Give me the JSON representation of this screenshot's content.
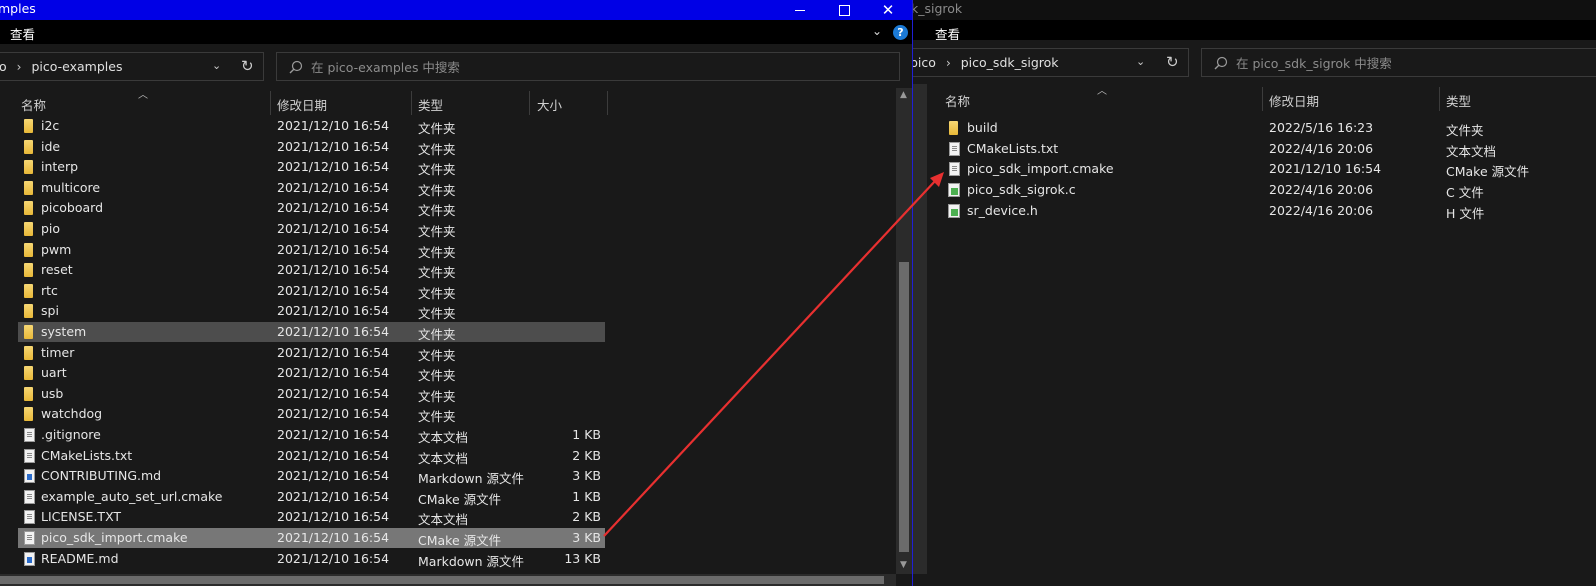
{
  "left": {
    "title": "mples",
    "ribbon": {
      "view_tab": "查看",
      "help": "?"
    },
    "address": {
      "prefix": "o",
      "folder": "pico-examples"
    },
    "search": {
      "placeholder": "在 pico-examples 中搜索"
    },
    "columns": {
      "name": "名称",
      "modified": "修改日期",
      "type": "类型",
      "size": "大小"
    },
    "rows": [
      {
        "name": "i2c",
        "modified": "2021/12/10 16:54",
        "type": "文件夹",
        "size": "",
        "icon": "folder-icon"
      },
      {
        "name": "ide",
        "modified": "2021/12/10 16:54",
        "type": "文件夹",
        "size": "",
        "icon": "folder-icon"
      },
      {
        "name": "interp",
        "modified": "2021/12/10 16:54",
        "type": "文件夹",
        "size": "",
        "icon": "folder-icon"
      },
      {
        "name": "multicore",
        "modified": "2021/12/10 16:54",
        "type": "文件夹",
        "size": "",
        "icon": "folder-icon"
      },
      {
        "name": "picoboard",
        "modified": "2021/12/10 16:54",
        "type": "文件夹",
        "size": "",
        "icon": "folder-icon"
      },
      {
        "name": "pio",
        "modified": "2021/12/10 16:54",
        "type": "文件夹",
        "size": "",
        "icon": "folder-icon"
      },
      {
        "name": "pwm",
        "modified": "2021/12/10 16:54",
        "type": "文件夹",
        "size": "",
        "icon": "folder-icon"
      },
      {
        "name": "reset",
        "modified": "2021/12/10 16:54",
        "type": "文件夹",
        "size": "",
        "icon": "folder-icon"
      },
      {
        "name": "rtc",
        "modified": "2021/12/10 16:54",
        "type": "文件夹",
        "size": "",
        "icon": "folder-icon"
      },
      {
        "name": "spi",
        "modified": "2021/12/10 16:54",
        "type": "文件夹",
        "size": "",
        "icon": "folder-icon"
      },
      {
        "name": "system",
        "modified": "2021/12/10 16:54",
        "type": "文件夹",
        "size": "",
        "icon": "folder-icon",
        "highlight": "hover"
      },
      {
        "name": "timer",
        "modified": "2021/12/10 16:54",
        "type": "文件夹",
        "size": "",
        "icon": "folder-icon"
      },
      {
        "name": "uart",
        "modified": "2021/12/10 16:54",
        "type": "文件夹",
        "size": "",
        "icon": "folder-icon"
      },
      {
        "name": "usb",
        "modified": "2021/12/10 16:54",
        "type": "文件夹",
        "size": "",
        "icon": "folder-icon"
      },
      {
        "name": "watchdog",
        "modified": "2021/12/10 16:54",
        "type": "文件夹",
        "size": "",
        "icon": "folder-icon"
      },
      {
        "name": ".gitignore",
        "modified": "2021/12/10 16:54",
        "type": "文本文档",
        "size": "1 KB",
        "icon": "text-file-icon"
      },
      {
        "name": "CMakeLists.txt",
        "modified": "2021/12/10 16:54",
        "type": "文本文档",
        "size": "2 KB",
        "icon": "text-file-icon"
      },
      {
        "name": "CONTRIBUTING.md",
        "modified": "2021/12/10 16:54",
        "type": "Markdown 源文件",
        "size": "3 KB",
        "icon": "markdown-file-icon"
      },
      {
        "name": "example_auto_set_url.cmake",
        "modified": "2021/12/10 16:54",
        "type": "CMake 源文件",
        "size": "1 KB",
        "icon": "text-file-icon"
      },
      {
        "name": "LICENSE.TXT",
        "modified": "2021/12/10 16:54",
        "type": "文本文档",
        "size": "2 KB",
        "icon": "text-file-icon"
      },
      {
        "name": "pico_sdk_import.cmake",
        "modified": "2021/12/10 16:54",
        "type": "CMake 源文件",
        "size": "3 KB",
        "icon": "text-file-icon",
        "highlight": "selected"
      },
      {
        "name": "README.md",
        "modified": "2021/12/10 16:54",
        "type": "Markdown 源文件",
        "size": "13 KB",
        "icon": "markdown-file-icon"
      }
    ]
  },
  "right": {
    "title": "k_sigrok",
    "ribbon": {
      "view_tab": "查看"
    },
    "address": {
      "prefix": "pico",
      "folder": "pico_sdk_sigrok"
    },
    "search": {
      "placeholder": "在 pico_sdk_sigrok 中搜索"
    },
    "columns": {
      "name": "名称",
      "modified": "修改日期",
      "type": "类型"
    },
    "rows": [
      {
        "name": "build",
        "modified": "2022/5/16 16:23",
        "type": "文件夹",
        "icon": "folder-icon"
      },
      {
        "name": "CMakeLists.txt",
        "modified": "2022/4/16 20:06",
        "type": "文本文档",
        "icon": "text-file-icon"
      },
      {
        "name": "pico_sdk_import.cmake",
        "modified": "2021/12/10 16:54",
        "type": "CMake 源文件",
        "icon": "text-file-icon"
      },
      {
        "name": "pico_sdk_sigrok.c",
        "modified": "2022/4/16 20:06",
        "type": "C 文件",
        "icon": "c-file-icon"
      },
      {
        "name": "sr_device.h",
        "modified": "2022/4/16 20:06",
        "type": "H 文件",
        "icon": "c-file-icon"
      }
    ]
  },
  "colors": {
    "title_active": "#0000e6",
    "arrow": "#e83030",
    "background": "#191919"
  }
}
